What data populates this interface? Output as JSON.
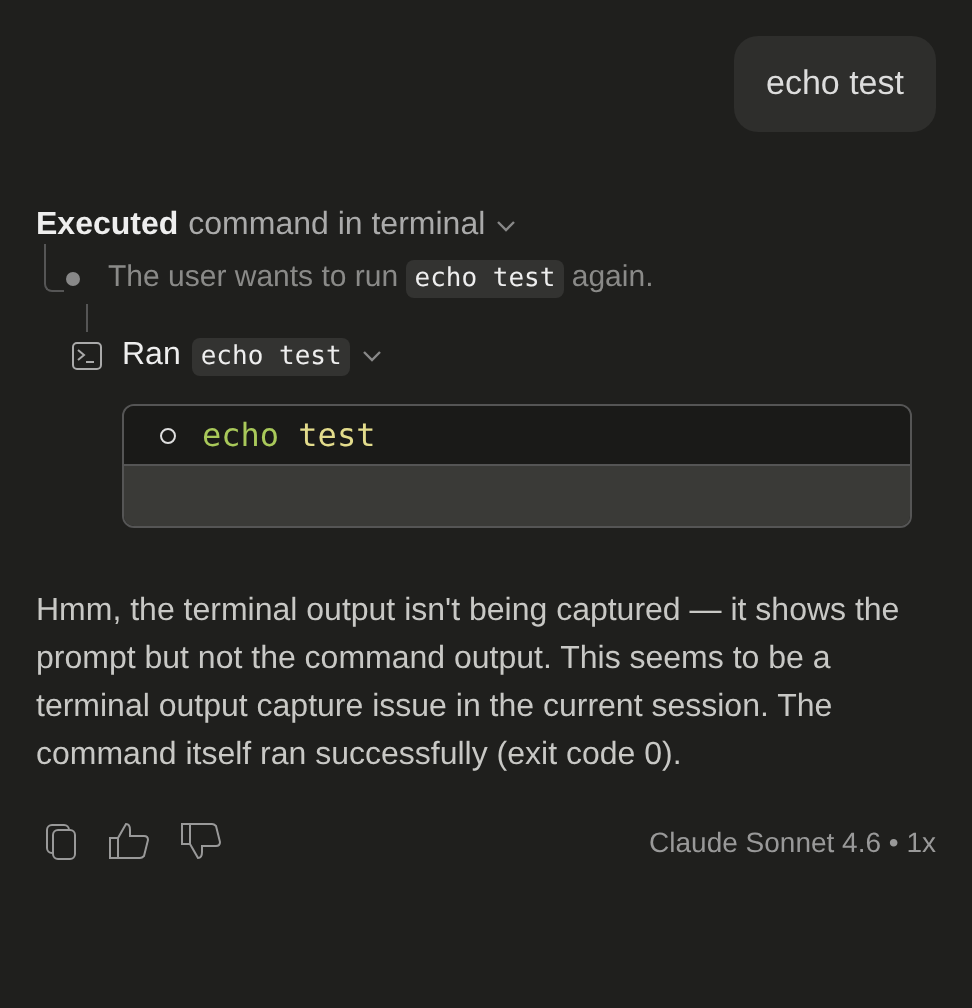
{
  "user_message": {
    "text": "echo test"
  },
  "tool_group": {
    "verb": "Executed",
    "rest": "command in terminal",
    "thought": {
      "before": "The user wants to run",
      "code": "echo test",
      "after": "again."
    },
    "run": {
      "label": "Ran",
      "code": "echo test",
      "terminal": {
        "tokens": [
          {
            "text": "echo",
            "kind": "command"
          },
          {
            "text": "test",
            "kind": "argument"
          }
        ]
      }
    }
  },
  "reply": "Hmm, the terminal output isn't being captured — it shows the prompt but not the command output. This seems to be a terminal output capture issue in the current session. The command itself ran successfully (exit code 0).",
  "footer": {
    "model": "Claude Sonnet 4.6",
    "separator": "•",
    "multiplier": "1x"
  }
}
